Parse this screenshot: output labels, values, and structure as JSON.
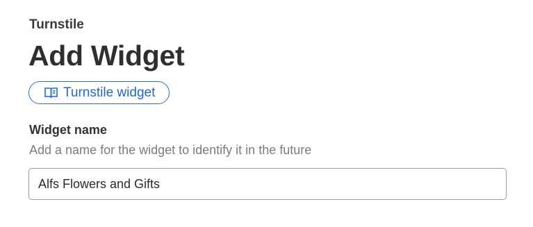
{
  "header": {
    "product": "Turnstile",
    "title": "Add Widget"
  },
  "docs_link": {
    "label": "Turnstile widget",
    "icon": "book-icon",
    "color": "#1f66d6"
  },
  "widget_name": {
    "label": "Widget name",
    "help": "Add a name for the widget to identify it in the future",
    "value": "Alfs Flowers and Gifts"
  }
}
